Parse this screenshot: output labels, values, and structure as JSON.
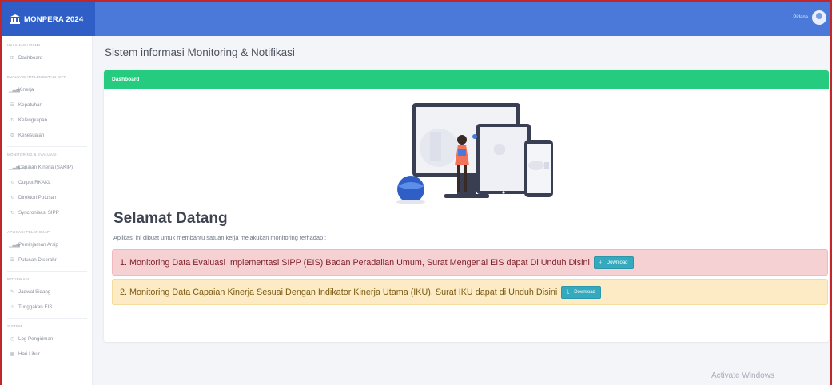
{
  "app": {
    "title": "MONPERA 2024",
    "user": "Pidana"
  },
  "sidebar": {
    "sections": [
      {
        "title": "HALAMAN UTAMA",
        "items": [
          {
            "label": "Dashboard",
            "icon": "grid-icon"
          }
        ]
      },
      {
        "title": "EVALUASI IMPLEMENTASI SIPP",
        "items": [
          {
            "label": "Kinerja",
            "icon": "bar-chart-icon"
          },
          {
            "label": "Kepatuhan",
            "icon": "list-icon"
          },
          {
            "label": "Kelengkapan",
            "icon": "refresh-icon"
          },
          {
            "label": "Kesesuaian",
            "icon": "gear-icon"
          }
        ]
      },
      {
        "title": "MONITORING & EVALUASI",
        "items": [
          {
            "label": "Capaian Kinerja (SAKIP)",
            "icon": "bar-chart-icon"
          },
          {
            "label": "Output RKAKL",
            "icon": "refresh-icon"
          },
          {
            "label": "Direktori Putusan",
            "icon": "refresh-icon"
          },
          {
            "label": "Syncronisasi SIPP",
            "icon": "refresh-icon"
          }
        ]
      },
      {
        "title": "APLIKASI PELENGKAP",
        "items": [
          {
            "label": "Peminjaman Arsip",
            "icon": "bar-chart-icon"
          },
          {
            "label": "Putusan Diserahr",
            "icon": "list-icon"
          }
        ]
      },
      {
        "title": "NOTIFIKASI",
        "items": [
          {
            "label": "Jadwal Sidang",
            "icon": "pin-icon"
          },
          {
            "label": "Tunggakan EIS",
            "icon": "warning-icon"
          }
        ]
      },
      {
        "title": "SISTEM",
        "items": [
          {
            "label": "Log Pengiriman",
            "icon": "history-icon"
          },
          {
            "label": "Hari Libur",
            "icon": "calendar-icon"
          }
        ]
      }
    ]
  },
  "main": {
    "page_title": "Sistem informasi Monitoring & Notifikasi",
    "card_header": "Dashboard",
    "welcome": "Selamat Datang",
    "description": "Aplikasi ini dibuat untuk membantu satuan kerja melakukan monitoring terhadap :",
    "alerts": [
      {
        "text": "1. Monitoring Data Evaluasi Implementasi SIPP (EIS) Badan Peradailan Umum, Surat Mengenai EIS dapat Di Unduh Disini",
        "button": "Download"
      },
      {
        "text": "2. Monitoring Data Capaian Kinerja Sesuai Dengan Indikator Kinerja Utama (IKU), Surat IKU dapat di Unduh Disini",
        "button": "Download"
      }
    ]
  },
  "watermark": "Activate Windows",
  "colors": {
    "topbar": "#4b79d9",
    "brand": "#2f5fc6",
    "card_header": "#25cc7f",
    "alert_danger": "#f6d1d3",
    "alert_warning": "#fcebc4",
    "button": "#35a9bd"
  }
}
